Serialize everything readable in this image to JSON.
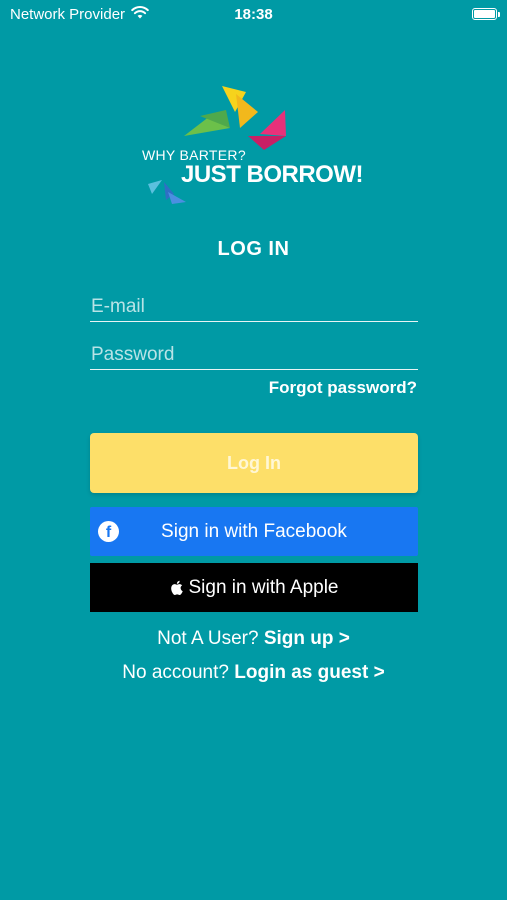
{
  "status_bar": {
    "carrier": "Network Provider",
    "time": "18:38",
    "battery_level": 1.0
  },
  "logo": {
    "tagline": "WHY BARTER?",
    "brand": "JUST BORROW!",
    "colors": [
      "#f6d31c",
      "#6cc04a",
      "#e8317a",
      "#5bc0de",
      "#3a7bd5"
    ]
  },
  "login": {
    "title": "LOG IN",
    "email_placeholder": "E-mail",
    "password_placeholder": "Password",
    "forgot_password": "Forgot password?",
    "login_button": "Log In",
    "facebook_button": "Sign in with Facebook",
    "apple_button": "Sign in with Apple"
  },
  "footer": {
    "not_user_text": "Not A User?",
    "sign_up_link": "Sign up >",
    "no_account_text": "No account?",
    "guest_link": "Login as guest >"
  },
  "colors": {
    "background": "#009aa5",
    "login_button": "#fddf69",
    "facebook": "#1877f2",
    "apple": "#000000"
  }
}
